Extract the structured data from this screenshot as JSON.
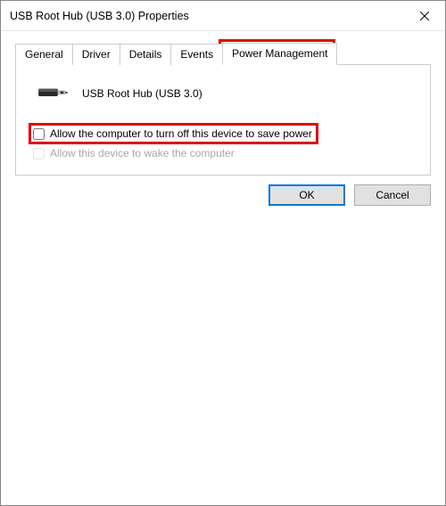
{
  "window": {
    "title": "USB Root Hub (USB 3.0) Properties"
  },
  "tabs": [
    {
      "label": "General"
    },
    {
      "label": "Driver"
    },
    {
      "label": "Details"
    },
    {
      "label": "Events"
    },
    {
      "label": "Power Management"
    }
  ],
  "active_tab_index": 4,
  "panel": {
    "device_name": "USB Root Hub (USB 3.0)",
    "options": [
      {
        "label": "Allow the computer to turn off this device to save power",
        "checked": false,
        "enabled": true,
        "highlighted": true
      },
      {
        "label": "Allow this device to wake the computer",
        "checked": false,
        "enabled": false,
        "highlighted": false
      }
    ]
  },
  "buttons": {
    "ok": "OK",
    "cancel": "Cancel"
  },
  "highlight_color": "#e3000f"
}
